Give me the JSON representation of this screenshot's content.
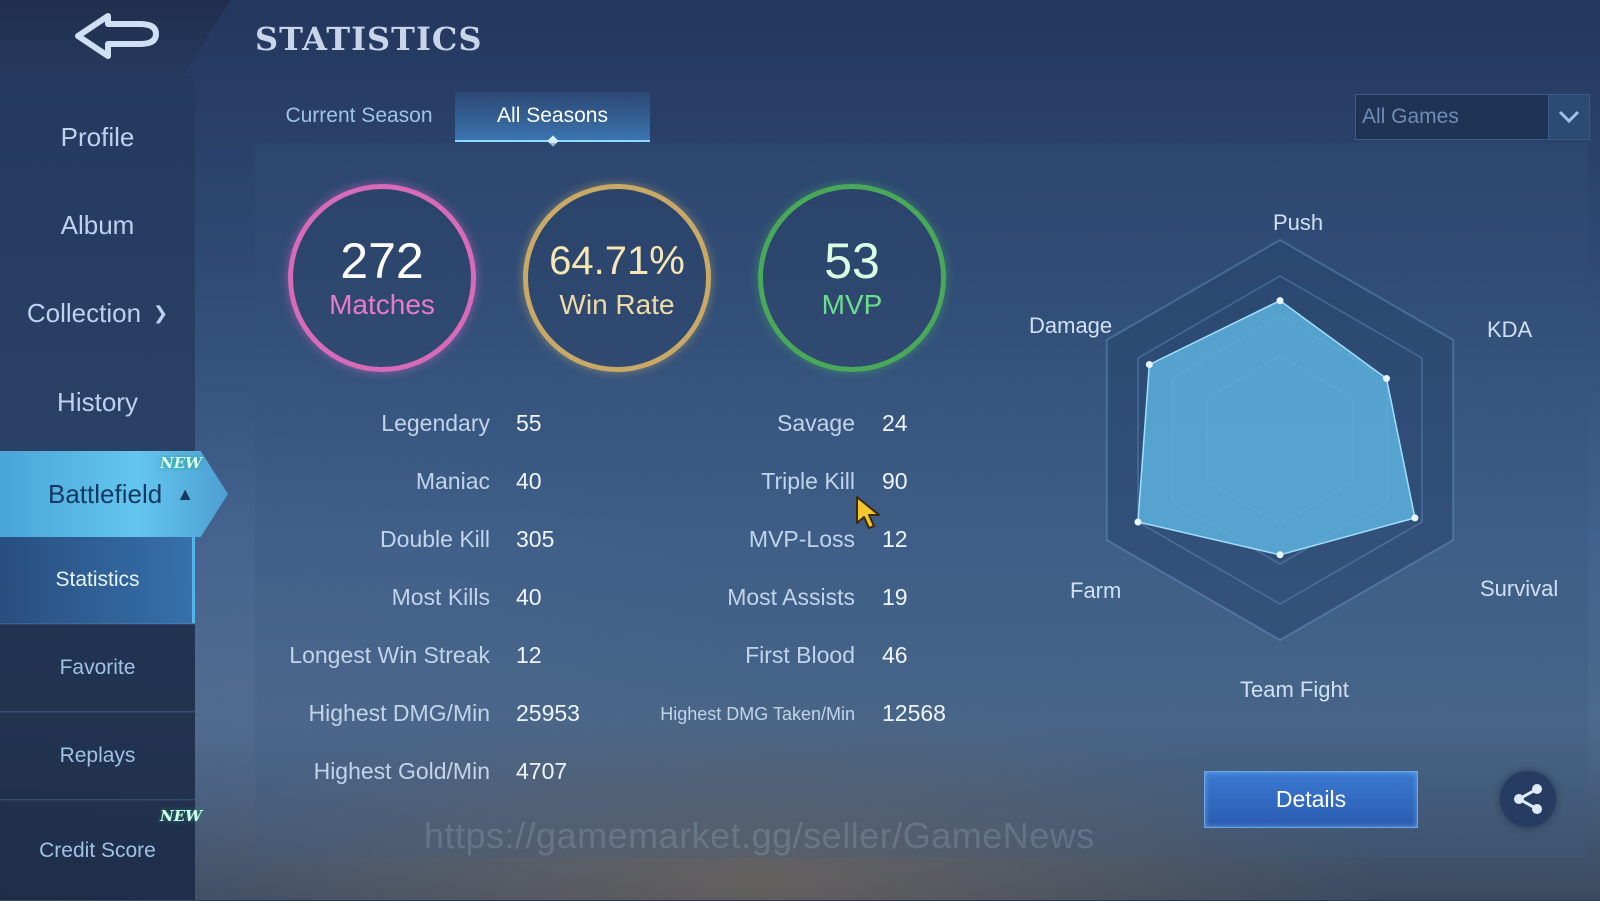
{
  "header": {
    "title": "STATISTICS"
  },
  "sidebar": {
    "items": [
      {
        "label": "Profile"
      },
      {
        "label": "Album"
      },
      {
        "label": "Collection"
      },
      {
        "label": "History"
      }
    ],
    "active_section": {
      "label": "Battlefield",
      "badge": "NEW"
    },
    "sub_items": [
      {
        "label": "Statistics"
      },
      {
        "label": "Favorite"
      },
      {
        "label": "Replays"
      },
      {
        "label": "Credit Score",
        "badge": "NEW"
      }
    ]
  },
  "tabs": [
    {
      "label": "Current Season"
    },
    {
      "label": "All Seasons"
    }
  ],
  "filter": {
    "selected": "All Games"
  },
  "summary": {
    "matches": {
      "value": "272",
      "label": "Matches"
    },
    "win_rate": {
      "value": "64.71%",
      "label": "Win Rate"
    },
    "mvp": {
      "value": "53",
      "label": "MVP"
    }
  },
  "stats_left": [
    {
      "label": "Legendary",
      "value": "55"
    },
    {
      "label": "Maniac",
      "value": "40"
    },
    {
      "label": "Double Kill",
      "value": "305"
    },
    {
      "label": "Most Kills",
      "value": "40"
    },
    {
      "label": "Longest Win Streak",
      "value": "12"
    },
    {
      "label": "Highest DMG/Min",
      "value": "25953"
    },
    {
      "label": "Highest Gold/Min",
      "value": "4707"
    }
  ],
  "stats_right": [
    {
      "label": "Savage",
      "value": "24"
    },
    {
      "label": "Triple Kill",
      "value": "90"
    },
    {
      "label": "MVP-Loss",
      "value": "12"
    },
    {
      "label": "Most Assists",
      "value": "19"
    },
    {
      "label": "First Blood",
      "value": "46"
    },
    {
      "label": "Highest DMG Taken/Min",
      "value": "12568"
    }
  ],
  "radar": {
    "labels": {
      "push": "Push",
      "kda": "KDA",
      "survival": "Survival",
      "team_fight": "Team Fight",
      "farm": "Farm",
      "damage": "Damage"
    },
    "levels": {
      "push": 0.85,
      "kda": 0.75,
      "survival": 0.95,
      "team_fight": 0.7,
      "farm": 1.0,
      "damage": 0.92
    },
    "fill_color": "#5fb6e3"
  },
  "actions": {
    "details": "Details"
  },
  "watermark": "https://gamemarket.gg/seller/GameNews",
  "colors": {
    "matches": "#d86bb8",
    "win_rate": "#c8a966",
    "mvp": "#4aa85a",
    "accent": "#4fb5ee"
  }
}
